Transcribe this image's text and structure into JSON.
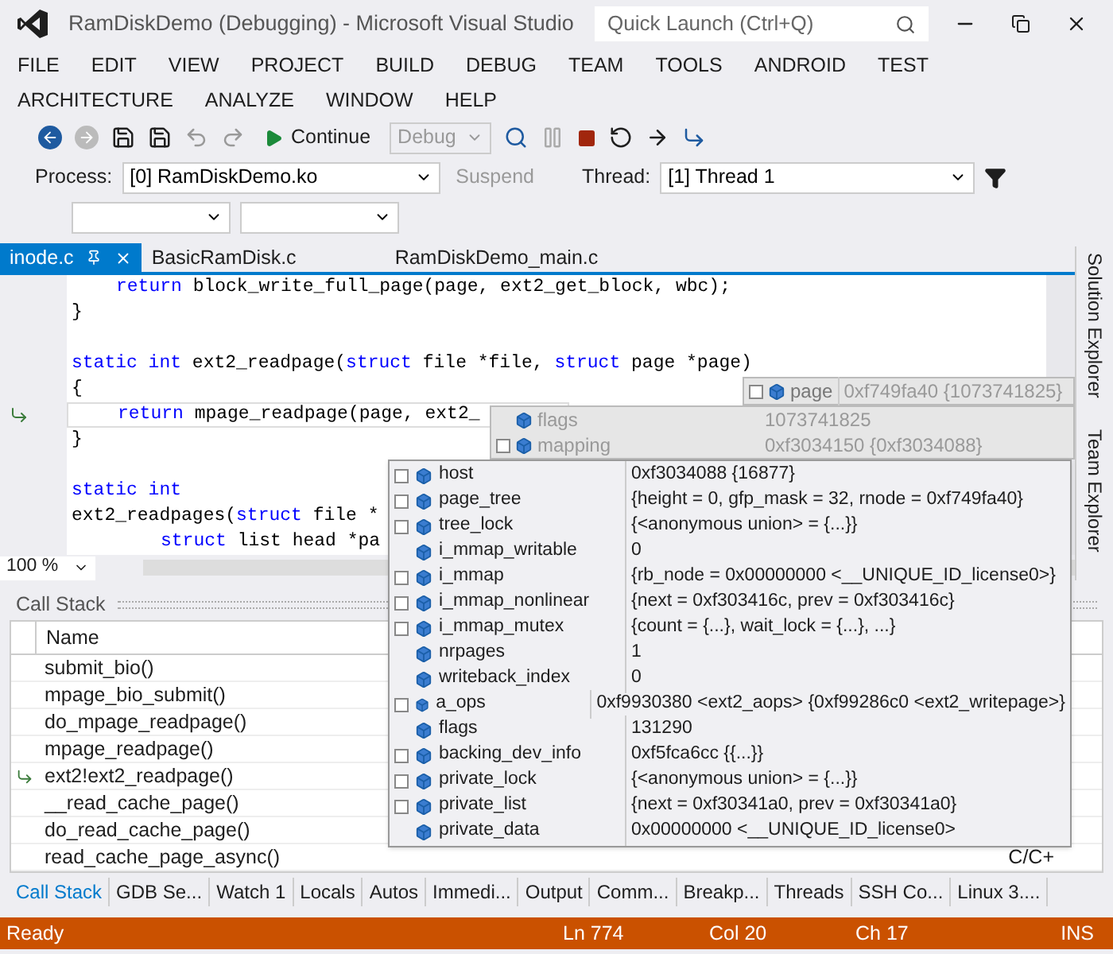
{
  "window": {
    "title": "RamDiskDemo (Debugging) - Microsoft Visual Studio"
  },
  "quick_launch": {
    "placeholder": "Quick Launch (Ctrl+Q)"
  },
  "menu": [
    "FILE",
    "EDIT",
    "VIEW",
    "PROJECT",
    "BUILD",
    "DEBUG",
    "TEAM",
    "TOOLS",
    "ANDROID",
    "TEST",
    "ARCHITECTURE",
    "ANALYZE",
    "WINDOW",
    "HELP"
  ],
  "toolbar": {
    "continue": "Continue",
    "configuration": "Debug",
    "process_label": "Process:",
    "process": "[0] RamDiskDemo.ko",
    "suspend": "Suspend",
    "thread_label": "Thread:",
    "thread": "[1] Thread 1"
  },
  "tabs": [
    {
      "label": "inode.c",
      "selected": true
    },
    {
      "label": "BasicRamDisk.c",
      "selected": false
    },
    {
      "label": "RamDiskDemo_main.c",
      "selected": false
    }
  ],
  "side_panels": [
    "Solution Explorer",
    "Team Explorer"
  ],
  "code": [
    {
      "kind": "inner",
      "tokens": [
        {
          "kind": "kw",
          "text": "return"
        },
        {
          "kind": "text",
          "text": " block_write_full_page(page, ext2_get_block, wbc);"
        }
      ]
    },
    {
      "kind": "close",
      "tokens": [
        {
          "kind": "text",
          "text": "}"
        }
      ]
    },
    {
      "kind": "blank"
    },
    {
      "kind": "decl",
      "tokens": [
        {
          "kind": "kw",
          "text": "static int"
        },
        {
          "kind": "text",
          "text": " ext2_readpage("
        },
        {
          "kind": "kw",
          "text": "struct"
        },
        {
          "kind": "text",
          "text": " file *file, "
        },
        {
          "kind": "kw",
          "text": "struct"
        },
        {
          "kind": "text",
          "text": " page *page)"
        }
      ]
    },
    {
      "kind": "close",
      "tokens": [
        {
          "kind": "text",
          "text": "{"
        }
      ]
    },
    {
      "kind": "inner",
      "current": true,
      "tokens": [
        {
          "kind": "kw",
          "text": "return"
        },
        {
          "kind": "text",
          "text": " mpage_readpage(page, ext2_"
        }
      ]
    },
    {
      "kind": "close",
      "tokens": [
        {
          "kind": "text",
          "text": "}"
        }
      ]
    },
    {
      "kind": "blank"
    },
    {
      "kind": "decl",
      "tokens": [
        {
          "kind": "kw",
          "text": "static int"
        }
      ]
    },
    {
      "kind": "close",
      "tokens": [
        {
          "kind": "text",
          "text": "ext2_readpages("
        },
        {
          "kind": "kw",
          "text": "struct"
        },
        {
          "kind": "text",
          "text": " file *"
        }
      ]
    },
    {
      "kind": "deep",
      "tokens": [
        {
          "kind": "kw",
          "text": "struct"
        },
        {
          "kind": "text",
          "text": " list head *pa"
        }
      ]
    }
  ],
  "zoom": "100 %",
  "datatip": {
    "name": "page",
    "value": "0xf749fa40 {1073741825}",
    "fields": [
      {
        "name": "flags",
        "value": "1073741825",
        "expandable": false
      },
      {
        "name": "mapping",
        "value": "0xf3034150 {0xf3034088}",
        "expandable": true
      }
    ],
    "mapping_fields": [
      {
        "name": "host",
        "value": "0xf3034088 {16877}",
        "expandable": true
      },
      {
        "name": "page_tree",
        "value": "{height = 0, gfp_mask = 32, rnode = 0xf749fa40}",
        "expandable": true
      },
      {
        "name": "tree_lock",
        "value": "{<anonymous union> = {...}}",
        "expandable": true
      },
      {
        "name": "i_mmap_writable",
        "value": "0",
        "expandable": false
      },
      {
        "name": "i_mmap",
        "value": "{rb_node = 0x00000000 <__UNIQUE_ID_license0>}",
        "expandable": true
      },
      {
        "name": "i_mmap_nonlinear",
        "value": "{next = 0xf303416c, prev = 0xf303416c}",
        "expandable": true
      },
      {
        "name": "i_mmap_mutex",
        "value": "{count = {...}, wait_lock = {...}, ...}",
        "expandable": true
      },
      {
        "name": "nrpages",
        "value": "1",
        "expandable": false
      },
      {
        "name": "writeback_index",
        "value": "0",
        "expandable": false
      },
      {
        "name": "a_ops",
        "value": "0xf9930380 <ext2_aops> {0xf99286c0 <ext2_writepage>}",
        "expandable": true
      },
      {
        "name": "flags",
        "value": "131290",
        "expandable": false
      },
      {
        "name": "backing_dev_info",
        "value": "0xf5fca6cc {{...}}",
        "expandable": true
      },
      {
        "name": "private_lock",
        "value": "{<anonymous union> = {...}}",
        "expandable": true
      },
      {
        "name": "private_list",
        "value": "{next = 0xf30341a0, prev = 0xf30341a0}",
        "expandable": true
      },
      {
        "name": "private_data",
        "value": "0x00000000 <__UNIQUE_ID_license0>",
        "expandable": false
      }
    ]
  },
  "call_stack": {
    "title": "Call Stack",
    "column": "Name",
    "language": "C/C+",
    "frames": [
      {
        "name": "submit_bio()",
        "current": false
      },
      {
        "name": "mpage_bio_submit()",
        "current": false
      },
      {
        "name": "do_mpage_readpage()",
        "current": false
      },
      {
        "name": "mpage_readpage()",
        "current": false
      },
      {
        "name": "ext2!ext2_readpage()",
        "current": true
      },
      {
        "name": "__read_cache_page()",
        "current": false
      },
      {
        "name": "do_read_cache_page()",
        "current": false
      },
      {
        "name": "read_cache_page_async()",
        "current": false
      }
    ]
  },
  "bottom_tabs": [
    {
      "label": "Call Stack",
      "selected": true
    },
    {
      "label": "GDB Se...",
      "selected": false
    },
    {
      "label": "Watch 1",
      "selected": false
    },
    {
      "label": "Locals",
      "selected": false
    },
    {
      "label": "Autos",
      "selected": false
    },
    {
      "label": "Immedi...",
      "selected": false
    },
    {
      "label": "Output",
      "selected": false
    },
    {
      "label": "Comm...",
      "selected": false
    },
    {
      "label": "Breakp...",
      "selected": false
    },
    {
      "label": "Threads",
      "selected": false
    },
    {
      "label": "SSH Co...",
      "selected": false
    },
    {
      "label": "Linux 3....",
      "selected": false
    }
  ],
  "status_bar": {
    "message": "Ready",
    "line": "Ln 774",
    "column": "Col 20",
    "char": "Ch 17",
    "mode": "INS"
  }
}
